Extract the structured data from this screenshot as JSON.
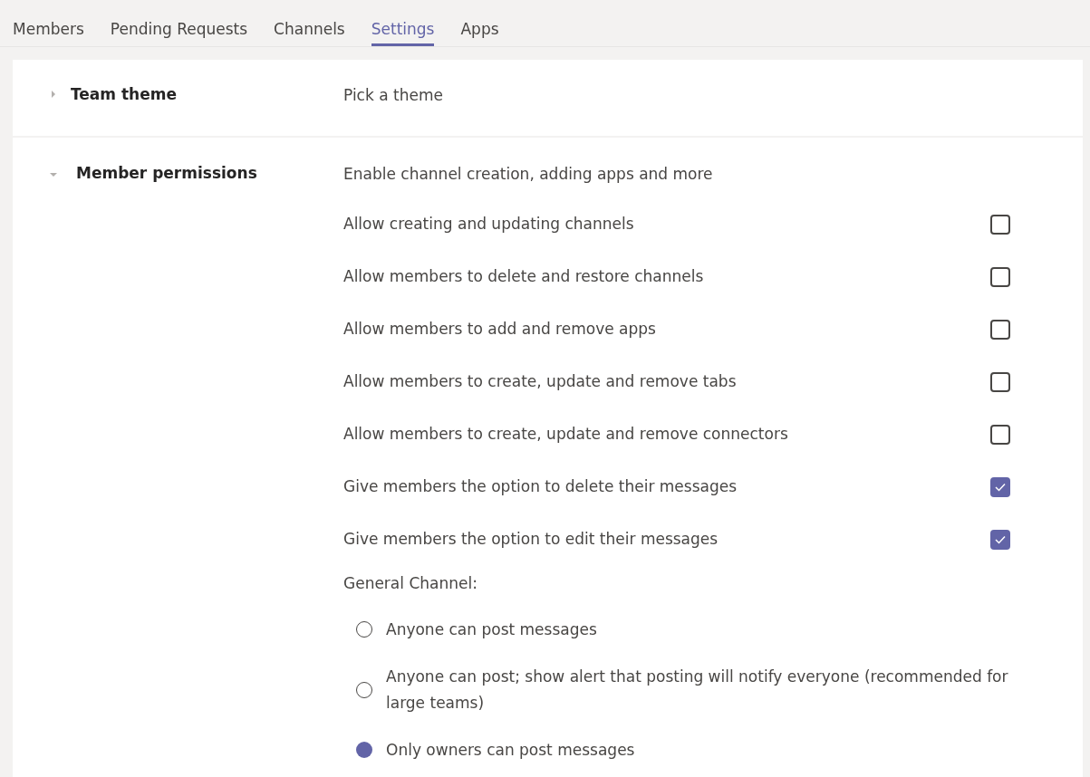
{
  "tabs": [
    {
      "label": "Members",
      "selected": false
    },
    {
      "label": "Pending Requests",
      "selected": false
    },
    {
      "label": "Channels",
      "selected": false
    },
    {
      "label": "Settings",
      "selected": true
    },
    {
      "label": "Apps",
      "selected": false
    }
  ],
  "sections": [
    {
      "title": "Team theme",
      "expanded": false,
      "description": "Pick a theme"
    },
    {
      "title": "Member permissions",
      "expanded": true,
      "description": "Enable channel creation, adding apps and more",
      "options": [
        {
          "label": "Allow creating and updating channels",
          "checked": false
        },
        {
          "label": "Allow members to delete and restore channels",
          "checked": false
        },
        {
          "label": "Allow members to add and remove apps",
          "checked": false
        },
        {
          "label": "Allow members to create, update and remove tabs",
          "checked": false
        },
        {
          "label": "Allow members to create, update and remove connectors",
          "checked": false
        },
        {
          "label": "Give members the option to delete their messages",
          "checked": true
        },
        {
          "label": "Give members the option to edit their messages",
          "checked": true
        }
      ],
      "group_label": "General Channel:",
      "radios": [
        {
          "label": "Anyone can post messages",
          "selected": false
        },
        {
          "label": "Anyone can post; show alert that posting will notify everyone (recommended for large teams)",
          "selected": false
        },
        {
          "label": "Only owners can post messages",
          "selected": true
        }
      ]
    }
  ]
}
